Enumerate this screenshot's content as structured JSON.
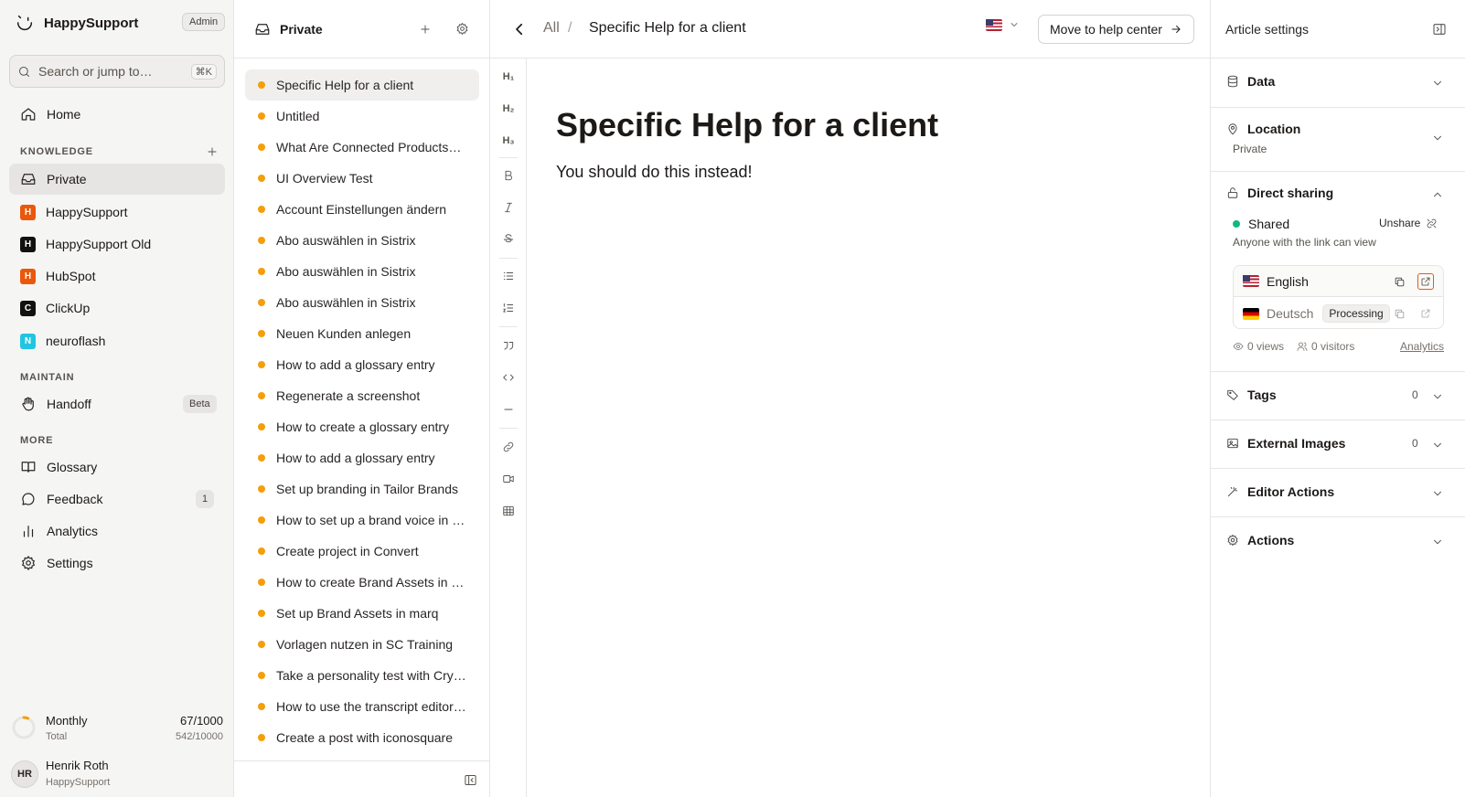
{
  "app": {
    "name": "HappySupport",
    "role_badge": "Admin"
  },
  "search": {
    "placeholder": "Search or jump to…",
    "shortcut": "⌘K"
  },
  "nav": {
    "home": "Home",
    "knowledge_label": "KNOWLEDGE",
    "knowledge_items": [
      {
        "label": "Private",
        "icon": "inbox-icon"
      },
      {
        "label": "HappySupport",
        "badge": "H",
        "color": "#ea580c"
      },
      {
        "label": "HappySupport Old",
        "badge": "H",
        "color": "#111111"
      },
      {
        "label": "HubSpot",
        "badge": "H",
        "color": "#ea580c"
      },
      {
        "label": "ClickUp",
        "badge": "C",
        "color": "#111111"
      },
      {
        "label": "neuroflash",
        "badge": "N",
        "color": "#22c5e0"
      }
    ],
    "maintain_label": "MAINTAIN",
    "handoff": "Handoff",
    "handoff_badge": "Beta",
    "more_label": "MORE",
    "glossary": "Glossary",
    "feedback": "Feedback",
    "feedback_count": "1",
    "analytics": "Analytics",
    "settings": "Settings"
  },
  "usage": {
    "title": "Monthly",
    "subtitle": "Total",
    "monthly": "67/1000",
    "total": "542/10000",
    "fraction": 0.067
  },
  "user": {
    "initials": "HR",
    "name": "Henrik Roth",
    "org": "HappySupport"
  },
  "list": {
    "title": "Private",
    "items": [
      "Specific Help for a client",
      "Untitled",
      "What Are Connected Products…",
      "UI Overview Test",
      "Account Einstellungen ändern",
      "Abo auswählen in Sistrix",
      "Abo auswählen in Sistrix",
      "Abo auswählen in Sistrix",
      "Neuen Kunden anlegen",
      "How to add a glossary entry",
      "Regenerate a screenshot",
      "How to create a glossary entry",
      "How to add a glossary entry",
      "Set up branding in Tailor Brands",
      "How to set up a brand voice in …",
      "Create project in Convert",
      "How to create Brand Assets in …",
      "Set up Brand Assets in marq",
      "Vorlagen nutzen in SC Training",
      "Take a personality test with Cry…",
      "How to use the transcript editor…",
      "Create a post with iconosquare"
    ]
  },
  "toolbar": {
    "h1": "H₁",
    "h2": "H₂",
    "h3": "H₃"
  },
  "header": {
    "crumb_all": "All",
    "crumb_sep": "/",
    "crumb_current": "Specific Help for a client",
    "language_flag": "🇺🇸",
    "move_button": "Move to help center"
  },
  "article": {
    "title": "Specific Help for a client",
    "body": "You should do this instead!"
  },
  "panel": {
    "title": "Article settings",
    "data": "Data",
    "location": "Location",
    "location_value": "Private",
    "direct_sharing": "Direct sharing",
    "share_status": "Shared",
    "unshare": "Unshare",
    "share_desc": "Anyone with the link can view",
    "languages": [
      {
        "name": "English",
        "flag": "🇺🇸"
      },
      {
        "name": "Deutsch",
        "flag": "🇩🇪",
        "status": "Processing"
      }
    ],
    "views": "0 views",
    "visitors": "0 visitors",
    "analytics_link": "Analytics",
    "tags": "Tags",
    "tags_count": "0",
    "external_images": "External Images",
    "external_images_count": "0",
    "editor_actions": "Editor Actions",
    "actions": "Actions"
  }
}
